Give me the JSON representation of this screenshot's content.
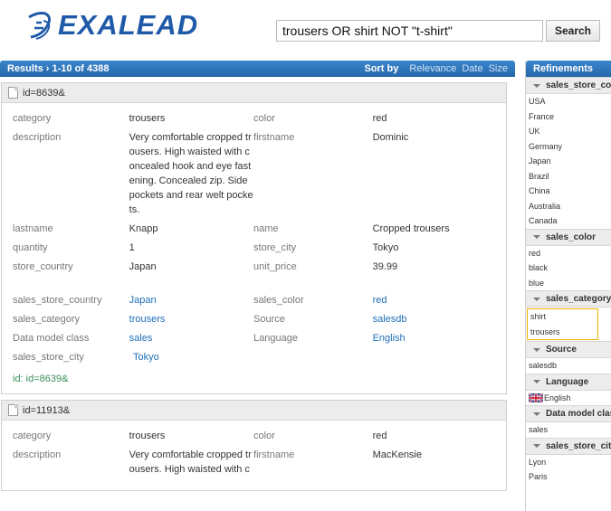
{
  "header": {
    "logo_text": "EXALEAD",
    "search_value": "trousers OR shirt NOT \"t-shirt\"",
    "search_button": "Search"
  },
  "results_bar": {
    "title": "Results › 1-10 of 4388",
    "sort_label": "Sort by",
    "sort_options": [
      "Relevance",
      "Date",
      "Size"
    ]
  },
  "hits": [
    {
      "title": "id=8639&",
      "rows": [
        [
          "category",
          "trousers",
          "color",
          "red"
        ],
        [
          "description",
          "Very comfortable cropped trousers. High waisted with concealed hook and eye fastening. Concealed zip. Side pockets and rear welt pockets.",
          "firstname",
          "Dominic"
        ],
        [
          "lastname",
          "Knapp",
          "name",
          "Cropped trousers"
        ],
        [
          "quantity",
          "1",
          "store_city",
          "Tokyo"
        ],
        [
          "store_country",
          "Japan",
          "unit_price",
          "39.99"
        ]
      ],
      "meta_rows": [
        [
          "sales_store_country",
          "Japan",
          "sales_color",
          "red"
        ],
        [
          "sales_category",
          "trousers",
          "Source",
          "salesdb"
        ],
        [
          "Data model class",
          "sales",
          "Language",
          "English"
        ],
        [
          "sales_store_city",
          "Tokyo",
          "",
          ""
        ]
      ],
      "id_text": "id: id=8639&"
    },
    {
      "title": "id=11913&",
      "rows": [
        [
          "category",
          "trousers",
          "color",
          "red"
        ],
        [
          "description",
          "Very comfortable cropped trousers. High waisted with c",
          "firstname",
          "MacKensie"
        ]
      ]
    }
  ],
  "refinements": {
    "title": "Refinements",
    "facets": [
      {
        "name": "sales_store_country",
        "items": [
          "USA",
          "France",
          "UK",
          "Germany",
          "Japan",
          "Brazil",
          "China",
          "Australia",
          "Canada"
        ]
      },
      {
        "name": "sales_color",
        "items": [
          "red",
          "black",
          "blue"
        ]
      },
      {
        "name": "sales_category",
        "items": [
          "shirt",
          "trousers"
        ]
      },
      {
        "name": "Source",
        "items": [
          "salesdb"
        ]
      },
      {
        "name": "Language",
        "items": [
          "English"
        ]
      },
      {
        "name": "Data model class",
        "items": [
          "sales"
        ]
      },
      {
        "name": "sales_store_city",
        "items": [
          "Lyon",
          "Paris"
        ]
      }
    ]
  }
}
